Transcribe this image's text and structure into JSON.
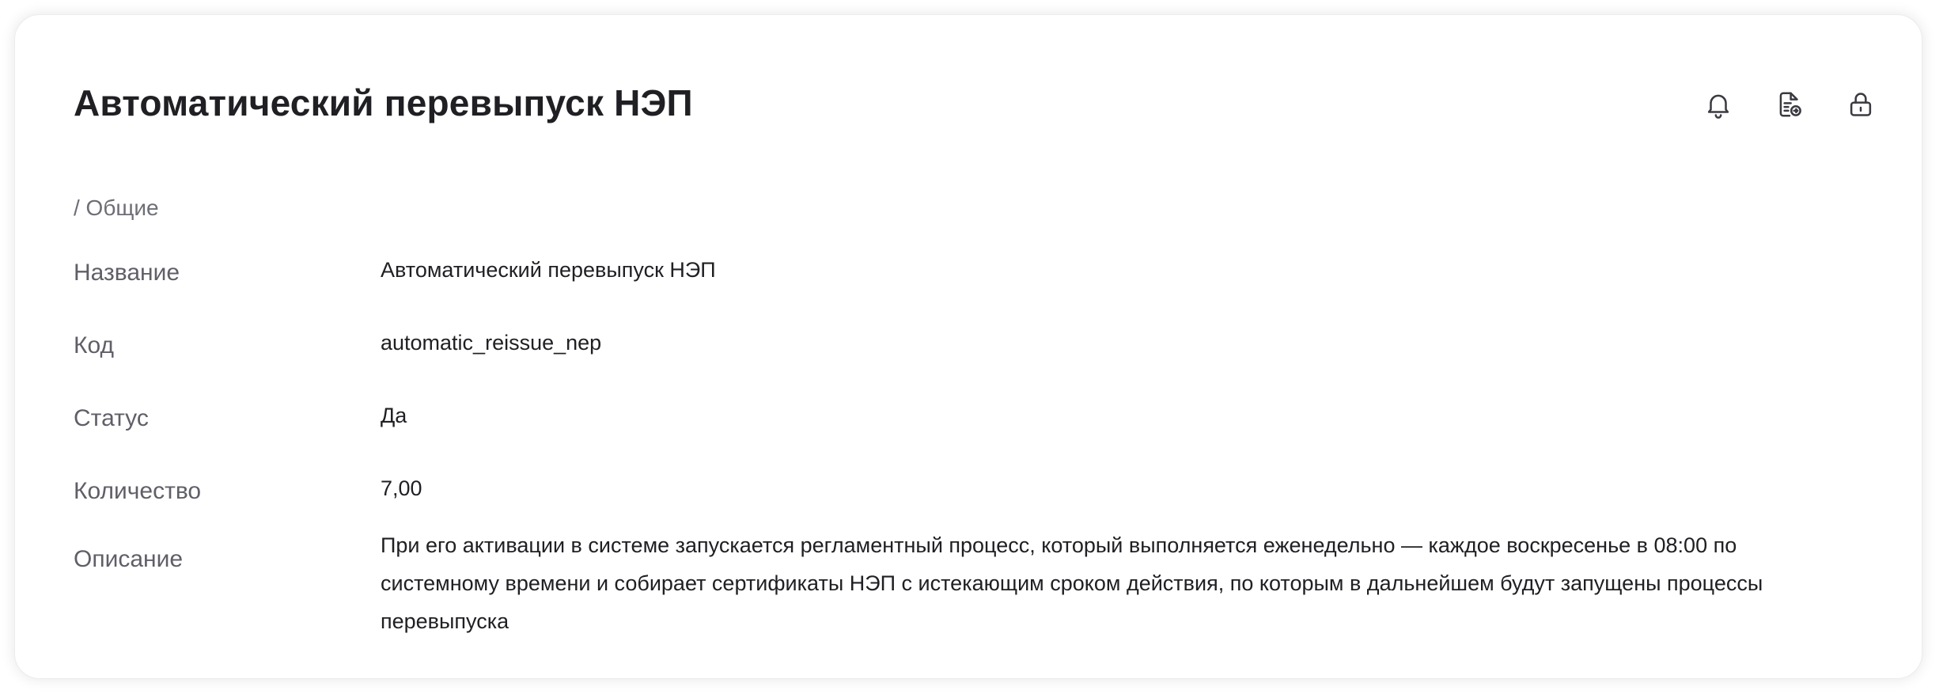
{
  "header": {
    "title": "Автоматический перевыпуск НЭП"
  },
  "toolbar": {
    "icons": [
      "bell-icon",
      "document-arrow-icon",
      "lock-icon"
    ]
  },
  "section": {
    "label": "/ Общие"
  },
  "fields": {
    "name": {
      "label": "Название",
      "value": "Автоматический перевыпуск НЭП"
    },
    "code": {
      "label": "Код",
      "value": "automatic_reissue_nep"
    },
    "status": {
      "label": "Статус",
      "value": "Да"
    },
    "quantity": {
      "label": "Количество",
      "value": "7,00"
    },
    "description": {
      "label": "Описание",
      "value": "При его активации в системе запускается регламентный процесс, который выполняется еженедельно — каждое воскресенье в 08:00 по системному времени и собирает сертификаты НЭП с истекающим сроком действия, по которым в дальнейшем будут запущены процессы перевыпуска"
    }
  }
}
